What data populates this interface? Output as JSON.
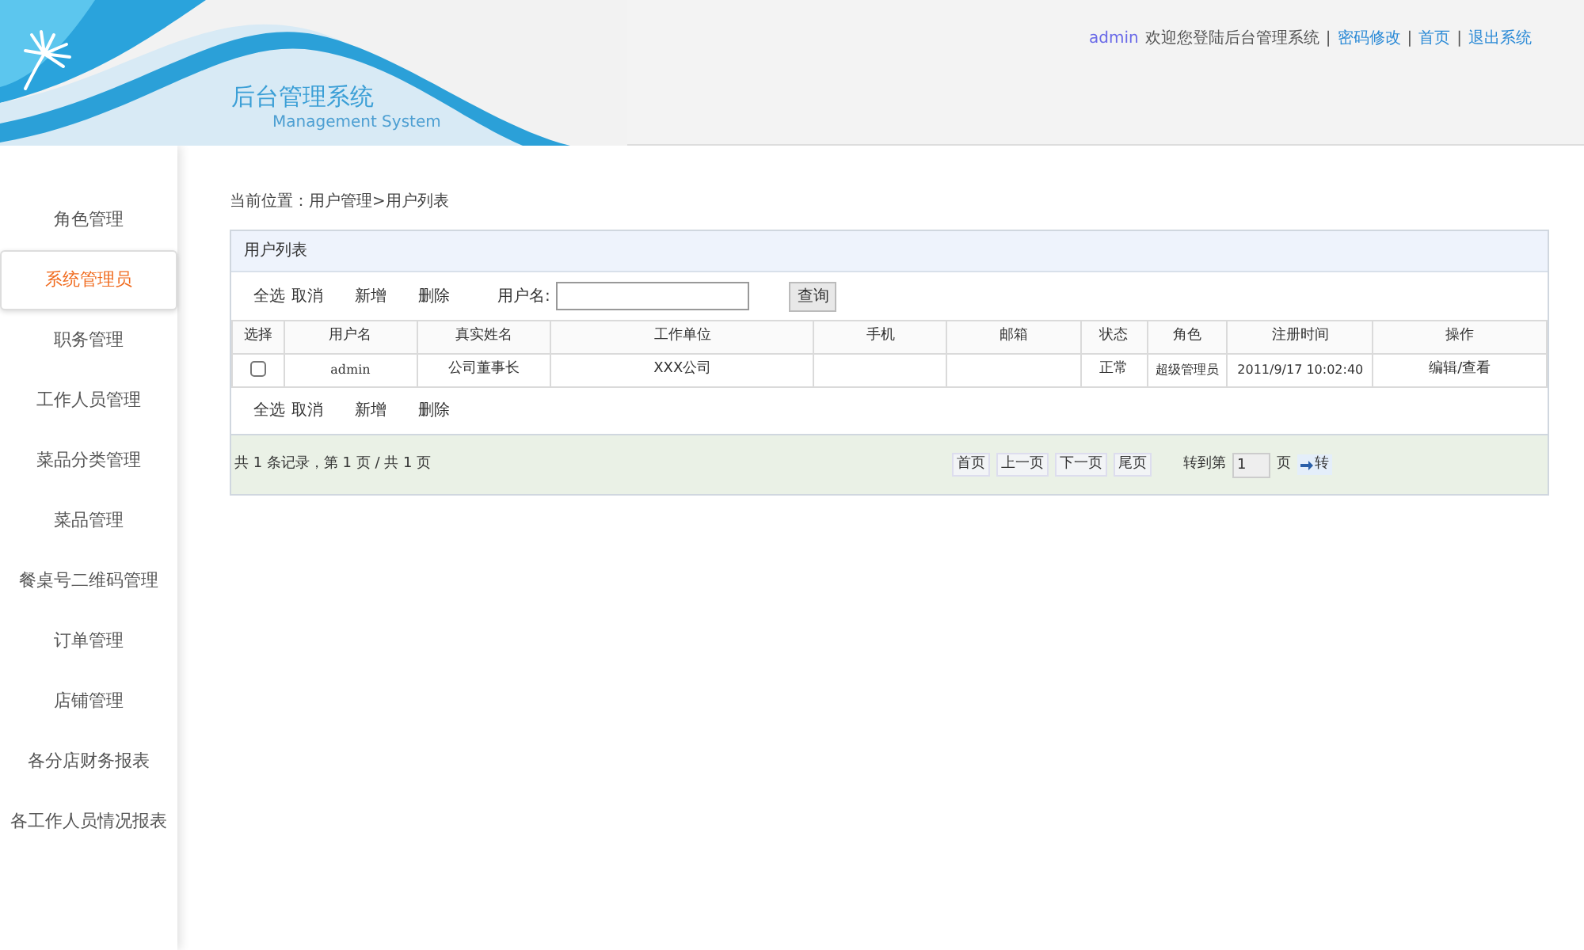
{
  "header": {
    "title": "后台管理系统",
    "subtitle": "Management System",
    "user": "admin",
    "welcome": "欢迎您登陆后台管理系统",
    "separator": "|",
    "links": [
      "密码修改",
      "首页",
      "退出系统"
    ]
  },
  "sidebar": {
    "items": [
      {
        "label": "角色管理",
        "selected": false
      },
      {
        "label": "系统管理员",
        "selected": true
      },
      {
        "label": "职务管理",
        "selected": false
      },
      {
        "label": "工作人员管理",
        "selected": false
      },
      {
        "label": "菜品分类管理",
        "selected": false
      },
      {
        "label": "菜品管理",
        "selected": false
      },
      {
        "label": "餐桌号二维码管理",
        "selected": false
      },
      {
        "label": "订单管理",
        "selected": false
      },
      {
        "label": "店铺管理",
        "selected": false
      },
      {
        "label": "各分店财务报表",
        "selected": false
      },
      {
        "label": "各工作人员情况报表",
        "selected": false
      }
    ]
  },
  "breadcrumb": "当前位置：用户管理>用户列表",
  "panel": {
    "title": "用户列表",
    "toolbar": {
      "actions": [
        "全选",
        "取消",
        "新增",
        "删除"
      ],
      "search_label": "用户名:",
      "search_button": "查询"
    },
    "table": {
      "columns": [
        "选择",
        "用户名",
        "真实姓名",
        "工作单位",
        "手机",
        "邮箱",
        "状态",
        "角色",
        "注册时间",
        "操作"
      ],
      "rows": [
        {
          "cells": [
            {
              "kind": "checkbox",
              "checked": false
            },
            {
              "kind": "text",
              "text": "admin"
            },
            {
              "kind": "text",
              "text": "公司董事长"
            },
            {
              "kind": "text",
              "text": "XXX公司"
            },
            {
              "kind": "text",
              "text": ""
            },
            {
              "kind": "text",
              "text": ""
            },
            {
              "kind": "text",
              "text": "正常"
            },
            {
              "kind": "text",
              "text": "超级管理员"
            },
            {
              "kind": "text",
              "text": "2011/9/17 10:02:40"
            },
            {
              "kind": "link",
              "text": "编辑/查看"
            }
          ]
        }
      ]
    },
    "footer_actions": [
      "全选",
      "取消",
      "新增",
      "删除"
    ],
    "pagination": {
      "summary": "共 1 条记录，第 1 页 / 共 1 页",
      "buttons": [
        "首页",
        "上一页",
        "下一页",
        "尾页"
      ],
      "goto_label": "转到第",
      "page_value": "1",
      "page_suffix": "页",
      "go_button": "转"
    }
  }
}
